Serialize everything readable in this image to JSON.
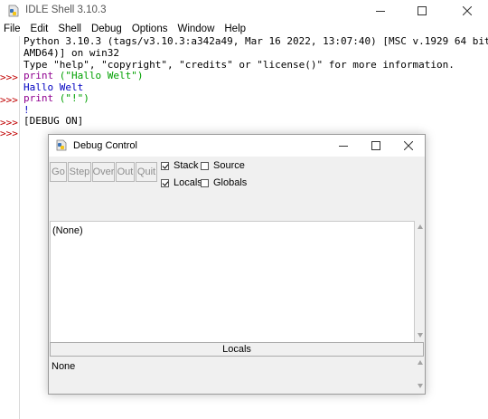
{
  "window": {
    "title": "IDLE Shell 3.10.3"
  },
  "menu": [
    "File",
    "Edit",
    "Shell",
    "Debug",
    "Options",
    "Window",
    "Help"
  ],
  "shell": {
    "prompt": ">>>",
    "banner": [
      "Python 3.10.3 (tags/v3.10.3:a342a49, Mar 16 2022, 13:07:40) [MSC v.1929 64 bit (",
      "AMD64)] on win32",
      "Type \"help\", \"copyright\", \"credits\" or \"license()\" for more information."
    ],
    "cmd1_kw": "print",
    "cmd1_str": "(\"Hallo Welt\")",
    "out1": "Hallo Welt",
    "cmd2_kw": "print",
    "cmd2_str": "(\"!\")",
    "out2": "!",
    "debug_msg": "[DEBUG ON]"
  },
  "debug": {
    "title": "Debug Control",
    "buttons": [
      "Go",
      "Step",
      "Over",
      "Out",
      "Quit"
    ],
    "checkboxes": {
      "stack": {
        "label": "Stack",
        "checked": true
      },
      "source": {
        "label": "Source",
        "checked": false
      },
      "locals": {
        "label": "Locals",
        "checked": true
      },
      "globals": {
        "label": "Globals",
        "checked": false
      }
    },
    "stack_text": "(None)",
    "locals_header": "Locals",
    "locals_text": "None"
  },
  "colors": {
    "prompt": "#c00000",
    "keyword": "#900090",
    "string": "#00a000",
    "output": "#0000c0"
  }
}
